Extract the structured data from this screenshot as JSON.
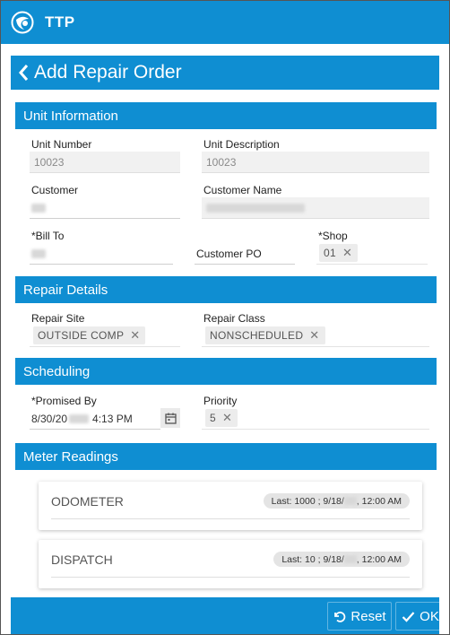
{
  "app": {
    "name": "TTP"
  },
  "page": {
    "title": "Add Repair Order"
  },
  "sections": {
    "unit_information": "Unit Information",
    "repair_details": "Repair Details",
    "scheduling": "Scheduling",
    "meter_readings": "Meter Readings"
  },
  "unit": {
    "unit_number_label": "Unit Number",
    "unit_number_value": "10023",
    "unit_description_label": "Unit Description",
    "unit_description_value": "10023",
    "customer_label": "Customer",
    "customer_name_label": "Customer Name",
    "bill_to_label": "*Bill To",
    "customer_po_label": "Customer PO",
    "customer_po_value": "",
    "shop_label": "*Shop",
    "shop_value": "01"
  },
  "repair": {
    "repair_site_label": "Repair Site",
    "repair_site_value": "OUTSIDE COMP",
    "repair_class_label": "Repair Class",
    "repair_class_value": "NONSCHEDULED"
  },
  "scheduling": {
    "promised_by_label": "*Promised By",
    "promised_by_date_prefix": "8/30/20",
    "promised_by_time": "4:13 PM",
    "priority_label": "Priority",
    "priority_value": "5"
  },
  "meters": [
    {
      "name": "ODOMETER",
      "last_prefix": "Last: 1000 ; 9/18/",
      "last_suffix": ", 12:00 AM"
    },
    {
      "name": "DISPATCH",
      "last_prefix": "Last: 10 ; 9/18/",
      "last_suffix": ", 12:00 AM"
    }
  ],
  "footer": {
    "reset_label": "Reset",
    "ok_label": "OK"
  },
  "colors": {
    "primary": "#0f8ed2",
    "chip_bg": "#ececec",
    "readonly_bg": "#f1f1f1"
  },
  "icons": [
    "app-logo-icon",
    "chevron-left-icon",
    "clear-x-icon",
    "calendar-icon",
    "reset-icon",
    "check-icon"
  ]
}
